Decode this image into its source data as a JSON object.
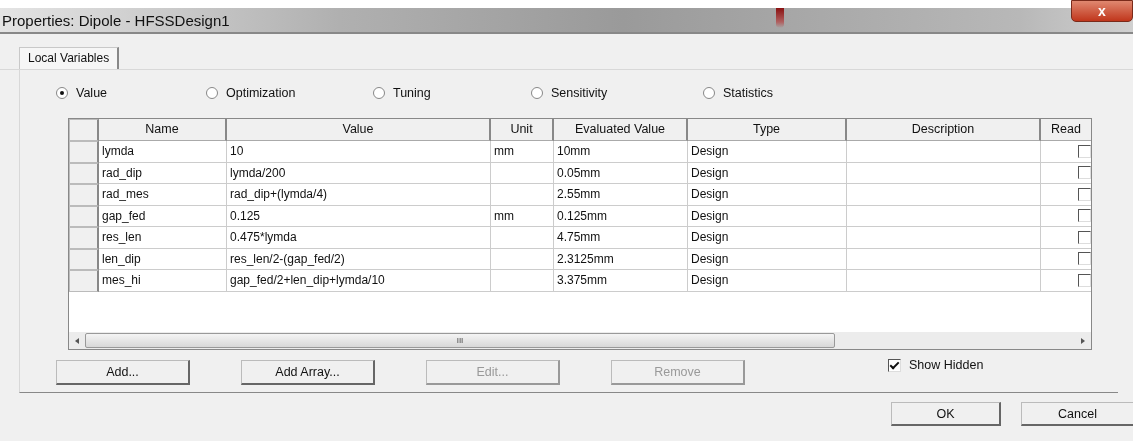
{
  "window": {
    "title": "Properties: Dipole - HFSSDesign1",
    "close": "x"
  },
  "tabs": [
    {
      "label": "Local Variables",
      "selected": true
    }
  ],
  "modes": [
    {
      "label": "Value",
      "selected": true
    },
    {
      "label": "Optimization",
      "selected": false
    },
    {
      "label": "Tuning",
      "selected": false
    },
    {
      "label": "Sensitivity",
      "selected": false
    },
    {
      "label": "Statistics",
      "selected": false
    }
  ],
  "table": {
    "columns": [
      "Name",
      "Value",
      "Unit",
      "Evaluated Value",
      "Type",
      "Description",
      "Read"
    ],
    "rows": [
      {
        "name": "lymda",
        "value": "10",
        "unit": "mm",
        "evaluated": "10mm",
        "type": "Design",
        "read": false
      },
      {
        "name": "rad_dip",
        "value": "lymda/200",
        "unit": "",
        "evaluated": "0.05mm",
        "type": "Design",
        "read": false
      },
      {
        "name": "rad_mes",
        "value": "rad_dip+(lymda/4)",
        "unit": "",
        "evaluated": "2.55mm",
        "type": "Design",
        "read": false
      },
      {
        "name": "gap_fed",
        "value": "0.125",
        "unit": "mm",
        "evaluated": "0.125mm",
        "type": "Design",
        "read": false
      },
      {
        "name": "res_len",
        "value": "0.475*lymda",
        "unit": "",
        "evaluated": "4.75mm",
        "type": "Design",
        "read": false
      },
      {
        "name": "len_dip",
        "value": "res_len/2-(gap_fed/2)",
        "unit": "",
        "evaluated": "2.3125mm",
        "type": "Design",
        "read": false
      },
      {
        "name": "mes_hi",
        "value": "gap_fed/2+len_dip+lymda/10",
        "unit": "",
        "evaluated": "3.375mm",
        "type": "Design",
        "read": false
      }
    ],
    "scroll_grip": "III"
  },
  "buttons": [
    {
      "label": "Add...",
      "disabled": false
    },
    {
      "label": "Add Array...",
      "disabled": false
    },
    {
      "label": "Edit...",
      "disabled": true
    },
    {
      "label": "Remove",
      "disabled": true
    }
  ],
  "show_hidden": {
    "label": "Show Hidden",
    "checked": true
  },
  "footer_buttons": [
    {
      "label": "OK"
    },
    {
      "label": "Cancel"
    }
  ]
}
